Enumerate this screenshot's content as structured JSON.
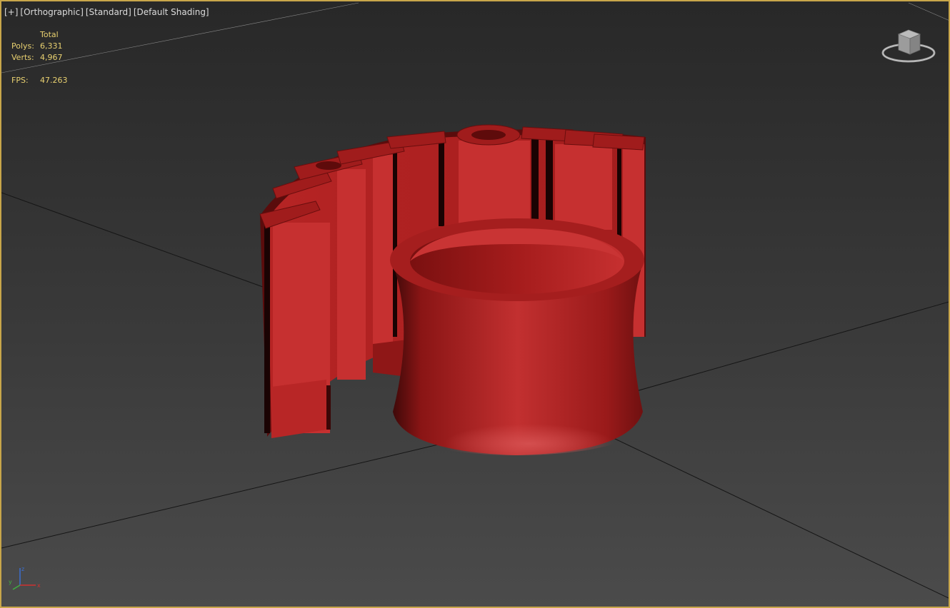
{
  "viewport": {
    "labels": [
      "[+]",
      "[Orthographic]",
      "[Standard]",
      "[Default Shading]"
    ],
    "stats": {
      "header": "Total",
      "polys_label": "Polys:",
      "polys_value": "6,331",
      "verts_label": "Verts:",
      "verts_value": "4,967",
      "fps_label": "FPS:",
      "fps_value": "47.263"
    },
    "viewcube_icon": "viewcube-icon",
    "axis_icon": "axis-tripod-icon",
    "axis_labels": [
      "z",
      "y",
      "x"
    ]
  },
  "colors": {
    "model": "#b02020",
    "border": "#c8a64a",
    "stats_text": "#e8d070"
  }
}
